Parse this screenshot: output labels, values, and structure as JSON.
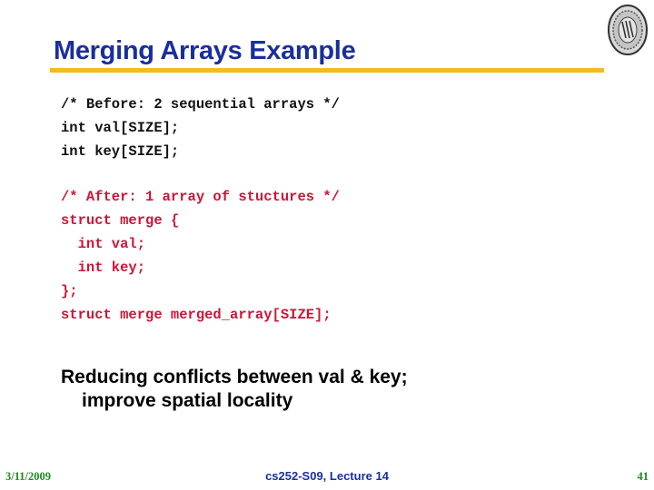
{
  "slide": {
    "title": "Merging Arrays Example",
    "logo": "university-seal-icon",
    "code_before": [
      "/* Before: 2 sequential arrays */",
      "int val[SIZE];",
      "int key[SIZE];"
    ],
    "code_after": [
      "/* After: 1 array of stuctures */",
      "struct merge {",
      "  int val;",
      "  int key;",
      "};",
      "struct merge merged_array[SIZE];"
    ],
    "bullet_line1": "Reducing conflicts between val & key;",
    "bullet_line2": "improve spatial locality",
    "colors": {
      "title": "#1a2f9c",
      "rule": "#f0bc1e",
      "code_after": "#cc1536",
      "footer_green": "#1e8a1e"
    }
  },
  "footer": {
    "date": "3/11/2009",
    "center": "cs252-S09, Lecture 14",
    "page": "41"
  }
}
